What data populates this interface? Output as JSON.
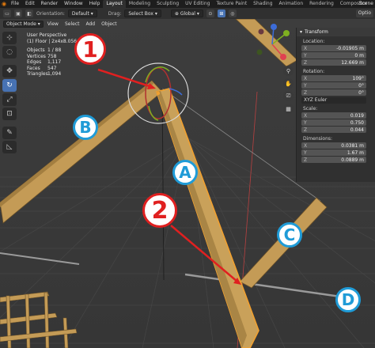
{
  "menubar": {
    "menus": [
      "File",
      "Edit",
      "Render",
      "Window",
      "Help"
    ],
    "workspaces": [
      "Layout",
      "Modeling",
      "Sculpting",
      "UV Editing",
      "Texture Paint",
      "Shading",
      "Animation",
      "Rendering",
      "Compositor"
    ],
    "scene": "Scene"
  },
  "toolheader": {
    "orientation_label": "Orientation:",
    "orientation_value": "Default",
    "drag_label": "Drag:",
    "drag_value": "Select Box",
    "pivot_value": "Global",
    "options_label": "Optio"
  },
  "viewport_header": {
    "mode": "Object Mode",
    "menus": [
      "View",
      "Select",
      "Add",
      "Object"
    ]
  },
  "overlay": {
    "view_name": "User Perspective",
    "object_name": "(1) Floor | 2x4x8.056",
    "stats": [
      {
        "key": "Objects",
        "value": "1 / 88"
      },
      {
        "key": "Vertices",
        "value": "758"
      },
      {
        "key": "Edges",
        "value": "1,117"
      },
      {
        "key": "Faces",
        "value": "547"
      },
      {
        "key": "Triangles",
        "value": "1,094"
      }
    ]
  },
  "npanel": {
    "header": "Transform",
    "location_label": "Location:",
    "location": [
      {
        "axis": "X",
        "value": "-0.01905 m"
      },
      {
        "axis": "Y",
        "value": "0 m"
      },
      {
        "axis": "Z",
        "value": "12.669 m"
      }
    ],
    "rotation_label": "Rotation:",
    "rotation": [
      {
        "axis": "X",
        "value": "109°"
      },
      {
        "axis": "Y",
        "value": "0°"
      },
      {
        "axis": "Z",
        "value": "0°"
      }
    ],
    "rotation_mode": "XYZ Euler",
    "scale_label": "Scale:",
    "scale": [
      {
        "axis": "X",
        "value": "0.019"
      },
      {
        "axis": "Y",
        "value": "0.750"
      },
      {
        "axis": "Z",
        "value": "0.044"
      }
    ],
    "dimensions_label": "Dimensions:",
    "dimensions": [
      {
        "axis": "X",
        "value": "0.0381 m"
      },
      {
        "axis": "Y",
        "value": "1.67 m"
      },
      {
        "axis": "Z",
        "value": "0.0889 m"
      }
    ]
  },
  "callouts": {
    "num1": "1",
    "num2": "2",
    "A": "A",
    "B": "B",
    "C": "C",
    "D": "D"
  },
  "colors": {
    "accent_blue": "#4772b3",
    "callout_red": "#e02020",
    "callout_blue": "#1f9bd7",
    "wood": "#c9a15a",
    "selection_orange": "#f0a030"
  },
  "icons": {
    "toolbar": [
      "cursor-icon",
      "select-box-icon",
      "move-icon",
      "rotate-icon",
      "scale-icon",
      "transform-icon",
      "annotate-icon",
      "measure-icon"
    ],
    "nav": [
      "zoom-icon",
      "hand-pan-icon",
      "camera-icon",
      "grid-view-icon"
    ]
  }
}
